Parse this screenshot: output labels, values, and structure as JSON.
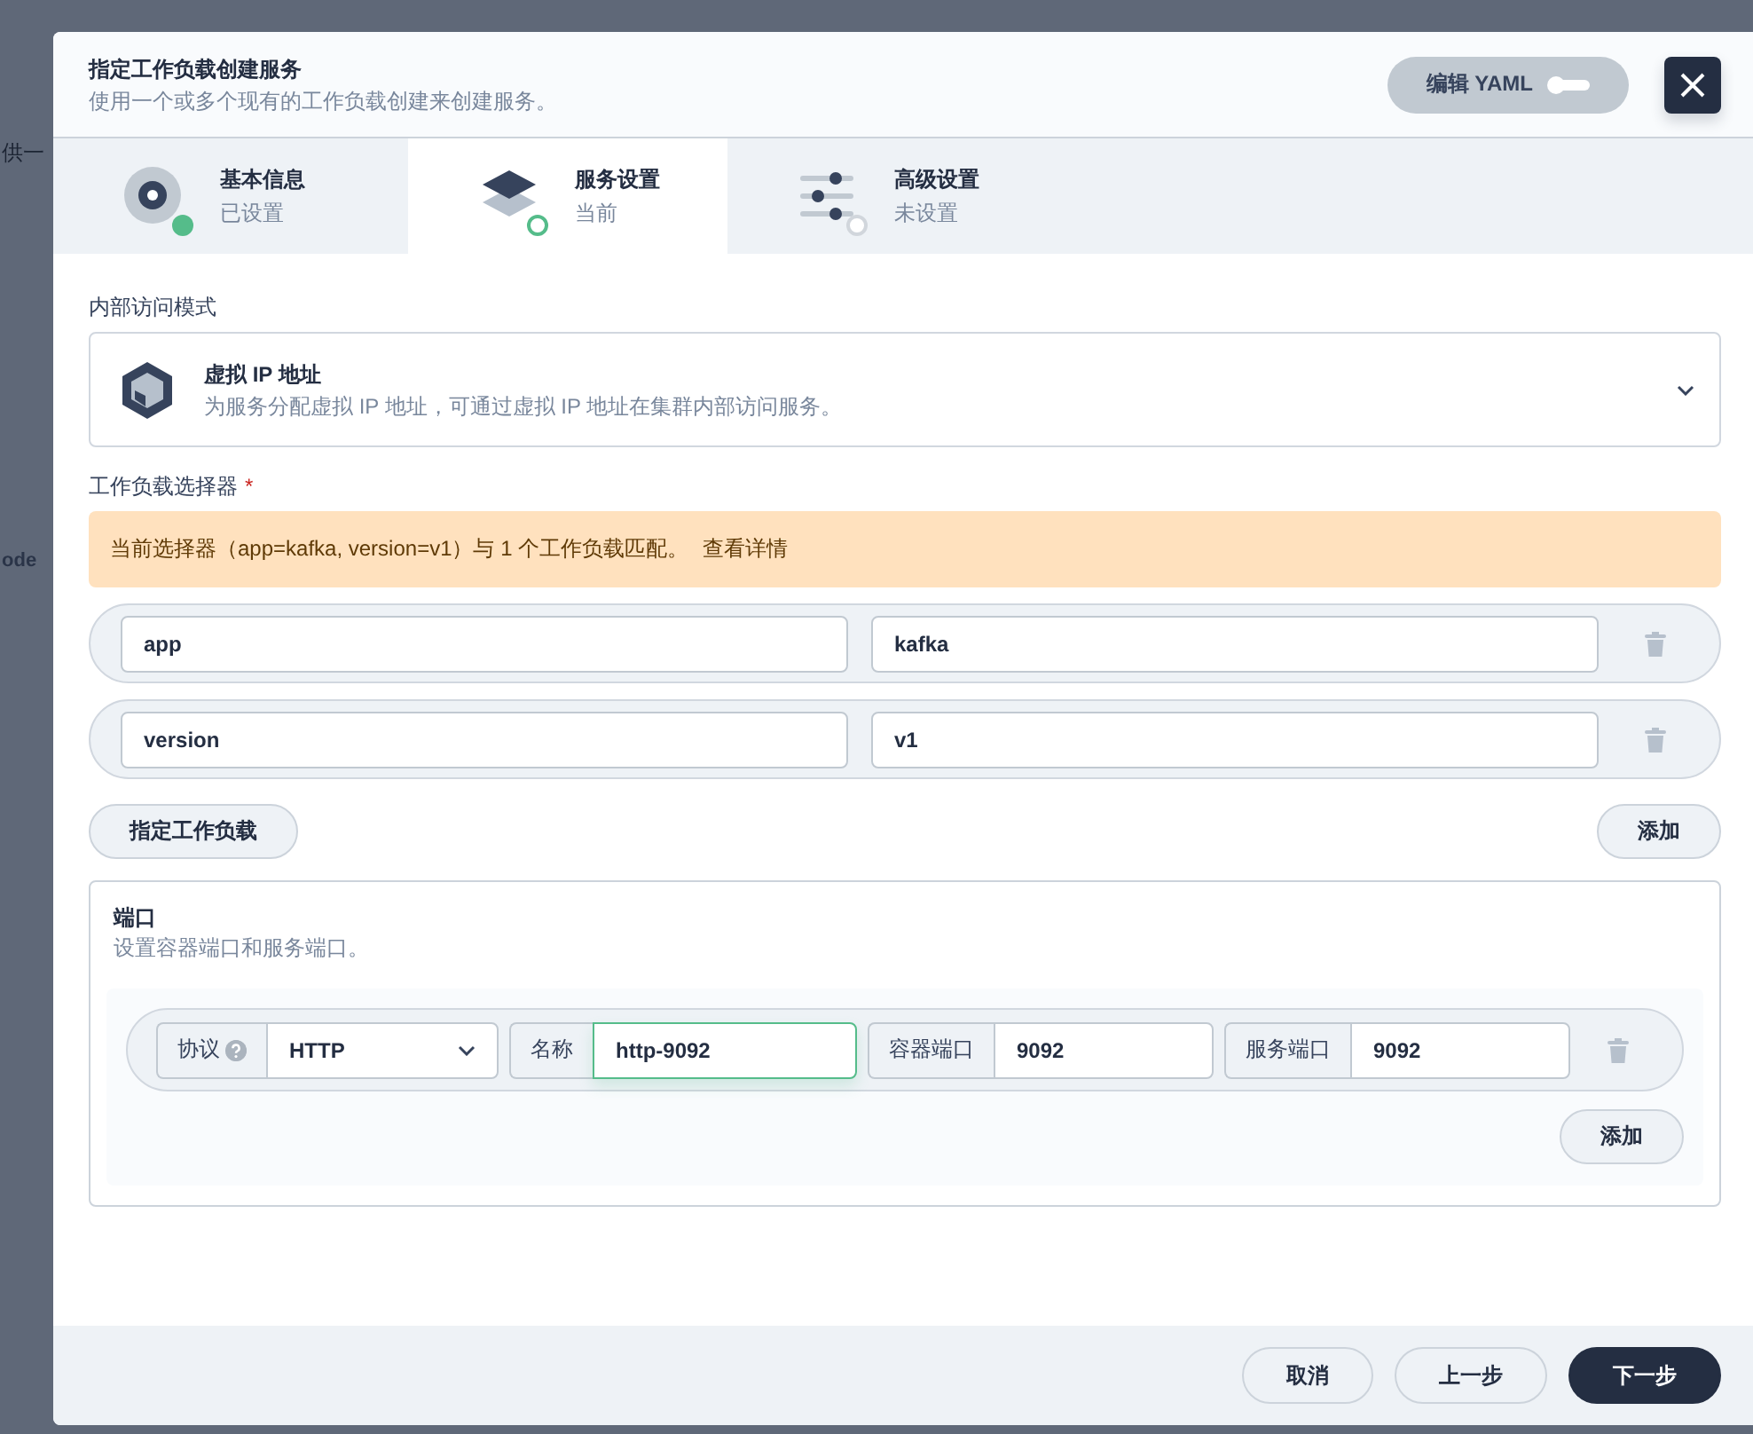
{
  "backdrop": {
    "texts": [
      "供一",
      "ode"
    ]
  },
  "dialog": {
    "title": "指定工作负载创建服务",
    "subtitle": "使用一个或多个现有的工作负载创建来创建服务。",
    "yaml_toggle": {
      "label": "编辑 YAML",
      "on": false
    }
  },
  "steps": [
    {
      "title": "基本信息",
      "status_text": "已设置",
      "kind": "done",
      "selected": false
    },
    {
      "title": "服务设置",
      "status_text": "当前",
      "kind": "current",
      "selected": true
    },
    {
      "title": "高级设置",
      "status_text": "未设置",
      "kind": "pending",
      "selected": false
    }
  ],
  "access_mode": {
    "label": "内部访问模式",
    "option": {
      "title": "虚拟 IP 地址",
      "description": "为服务分配虚拟 IP 地址，可通过虚拟 IP 地址在集群内部访问服务。"
    }
  },
  "selector": {
    "label": "工作负载选择器",
    "required_mark": "*",
    "alert": {
      "text": "当前选择器（app=kafka, version=v1）与 1 个工作负载匹配。",
      "link": "查看详情"
    },
    "rows": [
      {
        "key": "app",
        "value": "kafka"
      },
      {
        "key": "version",
        "value": "v1"
      }
    ],
    "specify_button": "指定工作负载",
    "add_button": "添加"
  },
  "ports": {
    "title": "端口",
    "description": "设置容器端口和服务端口。",
    "rows": [
      {
        "protocol_label": "协议",
        "protocol": "HTTP",
        "name_label": "名称",
        "name": "http-9092",
        "name_focused": true,
        "container_port_label": "容器端口",
        "container_port": "9092",
        "service_port_label": "服务端口",
        "service_port": "9092"
      }
    ],
    "add_button": "添加"
  },
  "footer": {
    "buttons": [
      {
        "label": "取消",
        "kind": "secondary"
      },
      {
        "label": "上一步",
        "kind": "secondary"
      },
      {
        "label": "下一步",
        "kind": "primary"
      }
    ]
  }
}
